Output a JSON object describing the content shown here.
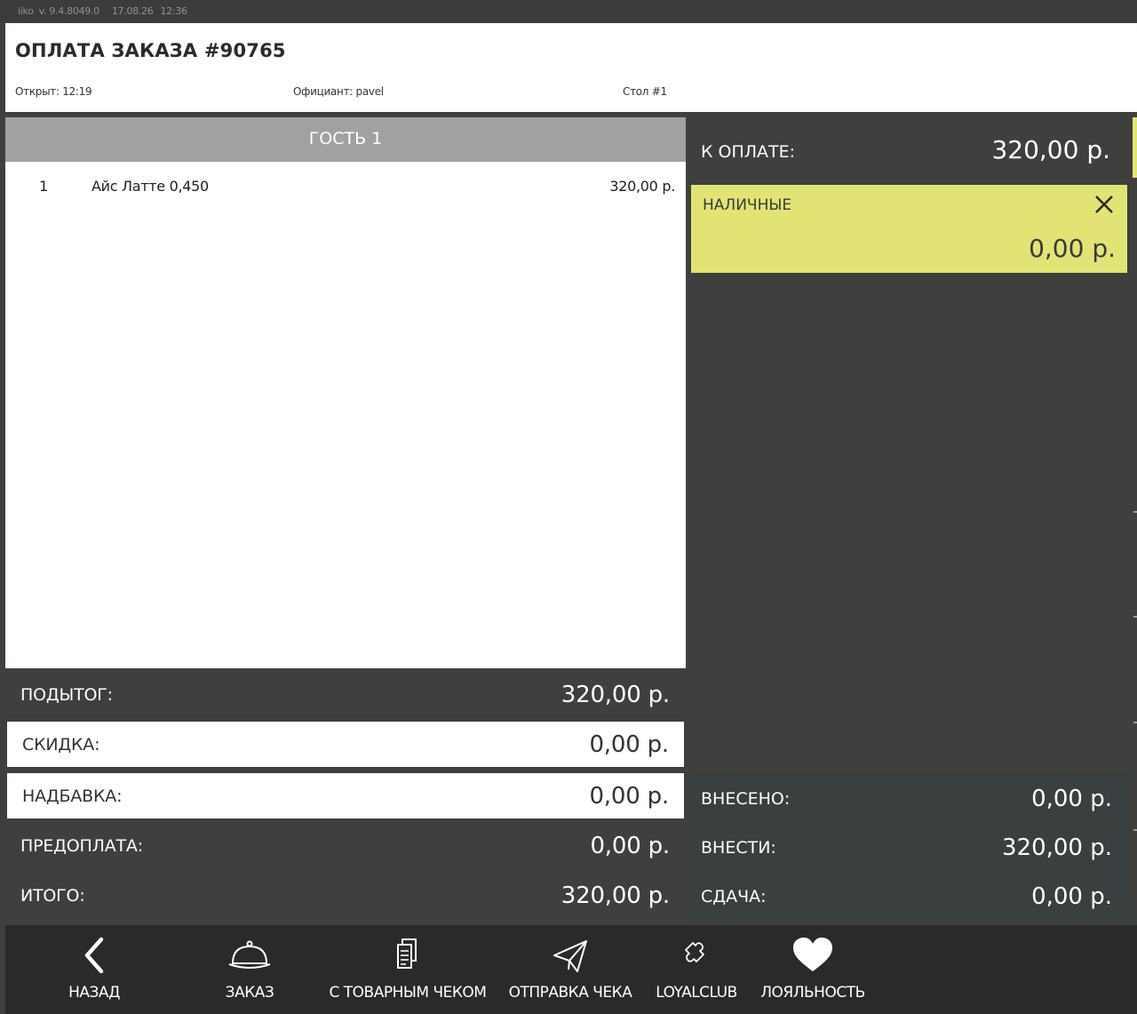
{
  "topbar": {
    "app": "iiko",
    "version": "v. 9.4.8049.0",
    "date": "17.08.26",
    "time": "12:36"
  },
  "header": {
    "title": "ОПЛАТА ЗАКАЗА #90765",
    "opened": "Открыт: 12:19",
    "waiter": "Официант: pavel",
    "table": "Стол #1"
  },
  "guest": {
    "title": "ГОСТЬ 1",
    "items": [
      {
        "qty": "1",
        "name": "Айс Латте 0,450",
        "price": "320,00 р."
      }
    ]
  },
  "summary": {
    "subtotal_label": "ПОДЫТОГ:",
    "subtotal": "320,00 р.",
    "discount_label": "СКИДКА:",
    "discount": "0,00 р.",
    "surcharge_label": "НАДБАВКА:",
    "surcharge": "0,00 р.",
    "prepay_label": "ПРЕДОПЛАТА:",
    "prepay": "0,00 р.",
    "total_label": "ИТОГО:",
    "total": "320,00 р."
  },
  "payment": {
    "to_pay_label": "К ОПЛАТЕ:",
    "to_pay": "320,00 р.",
    "method_label": "НАЛИЧНЫЕ",
    "method_amount": "0,00 р.",
    "paid_label": "ВНЕСЕНО:",
    "paid": "0,00 р.",
    "due_label": "ВНЕСТИ:",
    "due": "320,00 р.",
    "change_label": "СДАЧА:",
    "change": "0,00 р."
  },
  "toolbar": {
    "back": "НАЗАД",
    "order": "ЗАКАЗ",
    "receipt": "С ТОВАРНЫМ ЧЕКОМ",
    "send": "ОТПРАВКА ЧЕКА",
    "loyalclub": "LOYALCLUB",
    "loyalty": "ЛОЯЛЬНОСТЬ"
  },
  "colors": {
    "background": "#3d403c",
    "accent": "#e1e475",
    "toolbar": "#2a2a2a",
    "guest_header": "#a1a1a1"
  },
  "icons": [
    "chevron-left-icon",
    "cloche-icon",
    "receipt-icon",
    "paper-plane-icon",
    "puzzle-icon",
    "heart-icon",
    "close-icon"
  ]
}
